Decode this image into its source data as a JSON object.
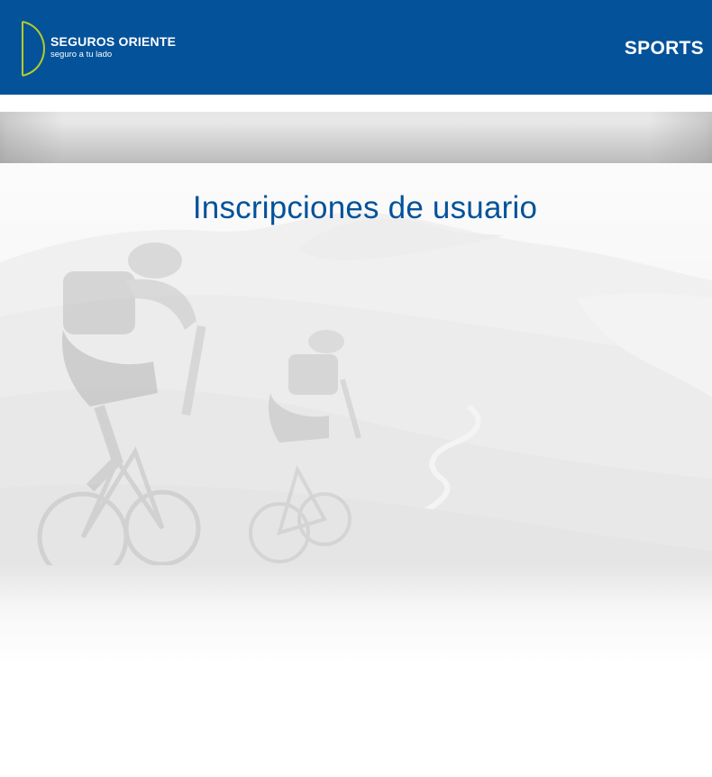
{
  "header": {
    "brand_name": "SEGUROS ORIENTE",
    "brand_tagline": "seguro a tu lado",
    "section": "SPORTS"
  },
  "main": {
    "title": "Inscripciones de usuario"
  },
  "colors": {
    "header_bg": "#03529a",
    "accent_green": "#b5cc2a",
    "title_blue": "#03529a"
  }
}
